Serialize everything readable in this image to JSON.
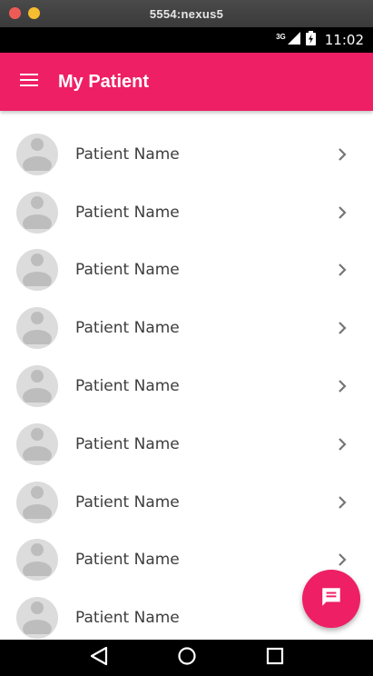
{
  "window": {
    "title": "5554:nexus5"
  },
  "status_bar": {
    "network": "3G",
    "time": "11:02"
  },
  "app_bar": {
    "title": "My Patient"
  },
  "patients": [
    {
      "name": "Patient Name"
    },
    {
      "name": "Patient Name"
    },
    {
      "name": "Patient Name"
    },
    {
      "name": "Patient Name"
    },
    {
      "name": "Patient Name"
    },
    {
      "name": "Patient Name"
    },
    {
      "name": "Patient Name"
    },
    {
      "name": "Patient Name"
    },
    {
      "name": "Patient Name"
    }
  ],
  "colors": {
    "primary": "#ee1f64",
    "status_bar": "#000000",
    "avatar_bg": "#dcdcdc",
    "avatar_fg": "#bdbdbd",
    "text": "#3d3d3d",
    "chevron": "#757575"
  },
  "icons": {
    "menu": "menu-icon",
    "avatar": "person-icon",
    "chevron": "chevron-right-icon",
    "fab": "chat-icon",
    "nav_back": "back-triangle-icon",
    "nav_home": "home-circle-icon",
    "nav_recents": "recents-square-icon"
  }
}
